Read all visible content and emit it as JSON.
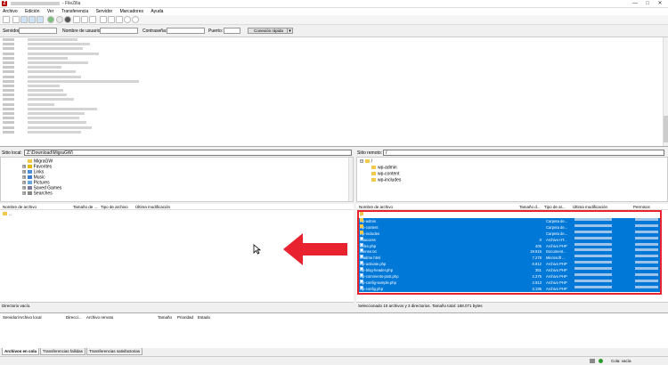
{
  "window": {
    "title": "- FileZilla",
    "controls": [
      "—",
      "□",
      "✕"
    ]
  },
  "menu": [
    "Archivo",
    "Edición",
    "Ver",
    "Transferencia",
    "Servidor",
    "Marcadores",
    "Ayuda"
  ],
  "quickconnect": {
    "server_label": "Servidor:",
    "user_label": "Nombre de usuario:",
    "password_label": "Contraseña:",
    "port_label": "Puerto:",
    "button": "Conexión rápida",
    "button_arrow": "▾"
  },
  "log_lines": 21,
  "local": {
    "site_label": "Sitio local:",
    "path": "Z:\\Download\\MigraGW\\",
    "tree": [
      {
        "label": "MigraGW",
        "indent": 1
      },
      {
        "label": "Favorites",
        "indent": 0
      },
      {
        "label": "Links",
        "indent": 0
      },
      {
        "label": "Music",
        "indent": 0
      },
      {
        "label": "Pictures",
        "indent": 0
      },
      {
        "label": "Saved Games",
        "indent": 0
      },
      {
        "label": "Searches",
        "indent": 0
      }
    ],
    "columns": [
      "Nombre de archivo",
      "Tamaño de ...",
      "Tipo de archivo",
      "Última modificación"
    ],
    "rows": [
      ".."
    ],
    "status": "Directorio vacío."
  },
  "remote": {
    "site_label": "Sitio remoto:",
    "path": "/",
    "tree": [
      {
        "label": "/",
        "indent": 0
      },
      {
        "label": "wp-admin",
        "indent": 1
      },
      {
        "label": "wp-content",
        "indent": 1
      },
      {
        "label": "wp-includes",
        "indent": 1
      }
    ],
    "columns": [
      "Nombre de archivo",
      "Tamaño d...",
      "Tipo de ar...",
      "Última modificación",
      "Permisos"
    ],
    "rows": [
      {
        "name": "..",
        "size": "",
        "type": "",
        "selected": false,
        "folder": true
      },
      {
        "name": "wp-admin",
        "size": "",
        "type": "Carpeta de...",
        "selected": true,
        "folder": true
      },
      {
        "name": "wp-content",
        "size": "",
        "type": "Carpeta de...",
        "selected": true,
        "folder": true
      },
      {
        "name": "wp-includes",
        "size": "",
        "type": "Carpeta de...",
        "selected": true,
        "folder": true
      },
      {
        "name": ".htaccess",
        "size": "0",
        "type": "Archivo HT...",
        "selected": true,
        "folder": false
      },
      {
        "name": "index.php",
        "size": "405",
        "type": "Archivo PHP",
        "selected": true,
        "folder": false
      },
      {
        "name": "license.txt",
        "size": "19.915",
        "type": "Document...",
        "selected": true,
        "folder": false
      },
      {
        "name": "readme.html",
        "size": "7.278",
        "type": "Microsoft ...",
        "selected": true,
        "folder": false
      },
      {
        "name": "wp-activate.php",
        "size": "6.912",
        "type": "Archivo PHP",
        "selected": true,
        "folder": false
      },
      {
        "name": "wp-blog-header.php",
        "size": "351",
        "type": "Archivo PHP",
        "selected": true,
        "folder": false
      },
      {
        "name": "wp-comments-post.php",
        "size": "2.275",
        "type": "Archivo PHP",
        "selected": true,
        "folder": false
      },
      {
        "name": "wp-config-sample.php",
        "size": "2.913",
        "type": "Archivo PHP",
        "selected": true,
        "folder": false
      },
      {
        "name": "wp-config.php",
        "size": "3.195",
        "type": "Archivo PHP",
        "selected": true,
        "folder": false
      }
    ],
    "status": "Seleccionado 10 archivos y 3 directorios. Tamaño total: 168.071 bytes"
  },
  "queue": {
    "columns": [
      "Servidor/Archivo local",
      "Direcci...",
      "Archivo remoto",
      "Tamaño",
      "Prioridad",
      "Estado"
    ],
    "tabs": [
      "Archivos en cola",
      "Transferencias fallidas",
      "Transferencias satisfactorias"
    ]
  },
  "bottom_status": {
    "queue_label": "Cola: vacía"
  },
  "colors": {
    "selection": "#0078d7",
    "highlight_box": "#e8232f",
    "arrow": "#e8232f"
  }
}
